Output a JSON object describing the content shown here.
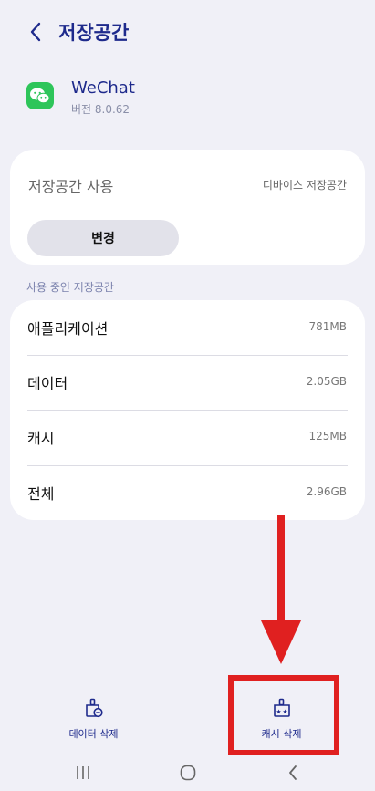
{
  "header": {
    "title": "저장공간"
  },
  "app": {
    "name": "WeChat",
    "version": "버전 8.0.62"
  },
  "storage_location": {
    "label": "저장공간 사용",
    "value": "디바이스 저장공간",
    "change_button": "변경"
  },
  "usage": {
    "section_label": "사용 중인 저장공간",
    "rows": [
      {
        "label": "애플리케이션",
        "value": "781MB"
      },
      {
        "label": "데이터",
        "value": "2.05GB"
      },
      {
        "label": "캐시",
        "value": "125MB"
      },
      {
        "label": "전체",
        "value": "2.96GB"
      }
    ]
  },
  "actions": {
    "clear_data": "데이터 삭제",
    "clear_cache": "캐시 삭제"
  },
  "colors": {
    "accent": "#1e2a8c",
    "highlight": "#e02020",
    "app_icon": "#2ec55a",
    "background": "#f0f0f7"
  },
  "icons": [
    "back-arrow-icon",
    "wechat-icon",
    "clear-data-icon",
    "clear-cache-icon",
    "recents-icon",
    "home-icon",
    "nav-back-icon"
  ]
}
